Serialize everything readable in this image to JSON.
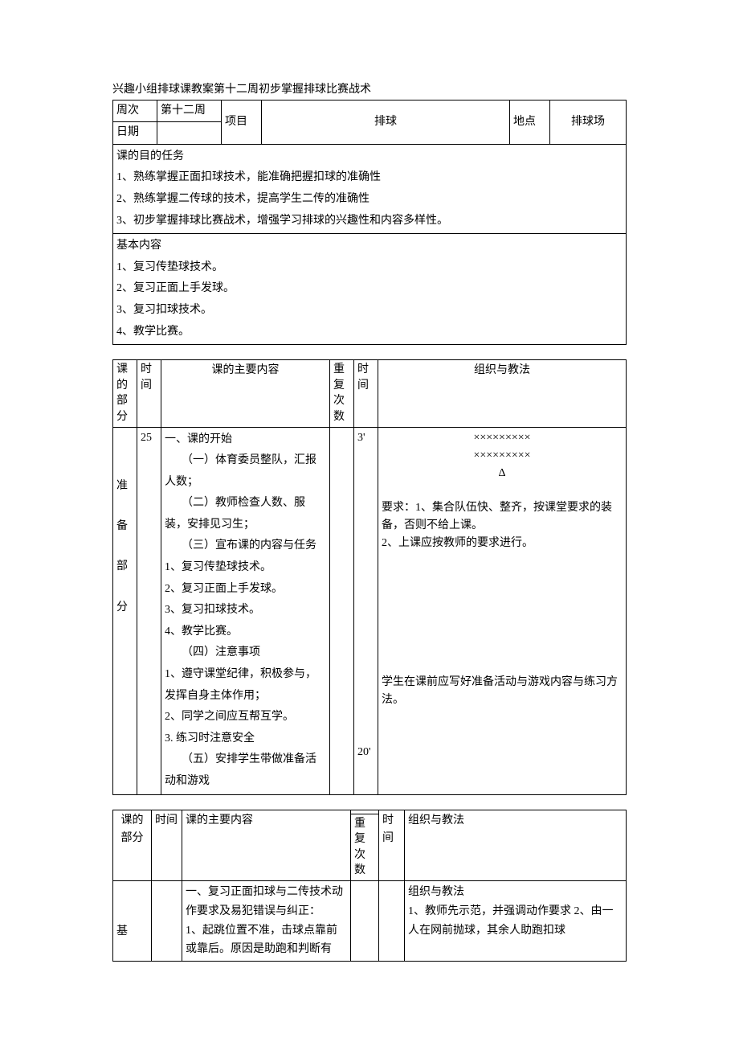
{
  "title": "兴趣小组排球课教案第十二周初步掌握排球比赛战术",
  "header": {
    "week_label": "周次",
    "week_value": "第十二周",
    "date_label": "日期",
    "date_value": "",
    "subject_label": "项目",
    "subject_value": "排球",
    "place_label": "地点",
    "place_value": "排球场"
  },
  "objectives": {
    "heading": "课的目的任务",
    "line1": "1、熟练掌握正面扣球技术，能准确把握扣球的准确性",
    "line2": "2、熟练掌握二传球的技术，提高学生二传的准确性",
    "line3": "3、初步掌握排球比赛战术，增强学习排球的兴趣性和内容多样性。"
  },
  "basics": {
    "heading": "基本内容",
    "line1": "1、复习传垫球技术。",
    "line2": "2、复习正面上手发球。",
    "line3": "3、复习扣球技术。",
    "line4": "4、教学比赛。"
  },
  "table2": {
    "h1": "课的部分",
    "h2": "时间",
    "h3": "课的主要内容",
    "h4": "重复次数",
    "h5": "时间",
    "h6": "组织与教法",
    "section_label": "准\n\n备\n\n部\n\n分",
    "time1": "25",
    "content": "一、课的开始\n　　（一）体育委员整队，汇报人数；\n　　（二）教师检查人数、服装，安排见习生；\n　　（三）宣布课的内容与任务\n1、复习传垫球技术。\n2、复习正面上手发球。\n3、复习扣球技术。\n4、教学比赛。\n　　（四）注意事项\n1、遵守课堂纪律，积极参与，发挥自身主体作用；\n2、同学之间应互帮互学。\n3. 练习时注意安全\n　　（五）安排学生带做准备活动和游戏",
    "reps": "",
    "time2_top": "3'",
    "time2_bottom": "20'",
    "org_symbols": "×××××××××\n×××××××××\nΔ",
    "org_req": "要求：1、集合队伍快、整齐，按课堂要求的装备，否则不给上课。\n2、上课应按教师的要求进行。",
    "org_note": "学生在课前应写好准备活动与游戏内容与练习方法。"
  },
  "table3": {
    "h1": "课的部分",
    "h2": "时间",
    "h3": "课的主要内容",
    "h4": "重复次数",
    "h5": "时间",
    "h6": "组织与教法",
    "section_label": "基",
    "content": "一、复习正面扣球与二传技术动作要求及易犯错误与纠正：\n1、起跳位置不准，击球点靠前或靠后。原因是助跑和判断有",
    "org": "组织与教法\n1、教师先示范，并强调动作要求 2、由一人在网前抛球，其余人助跑扣球"
  }
}
